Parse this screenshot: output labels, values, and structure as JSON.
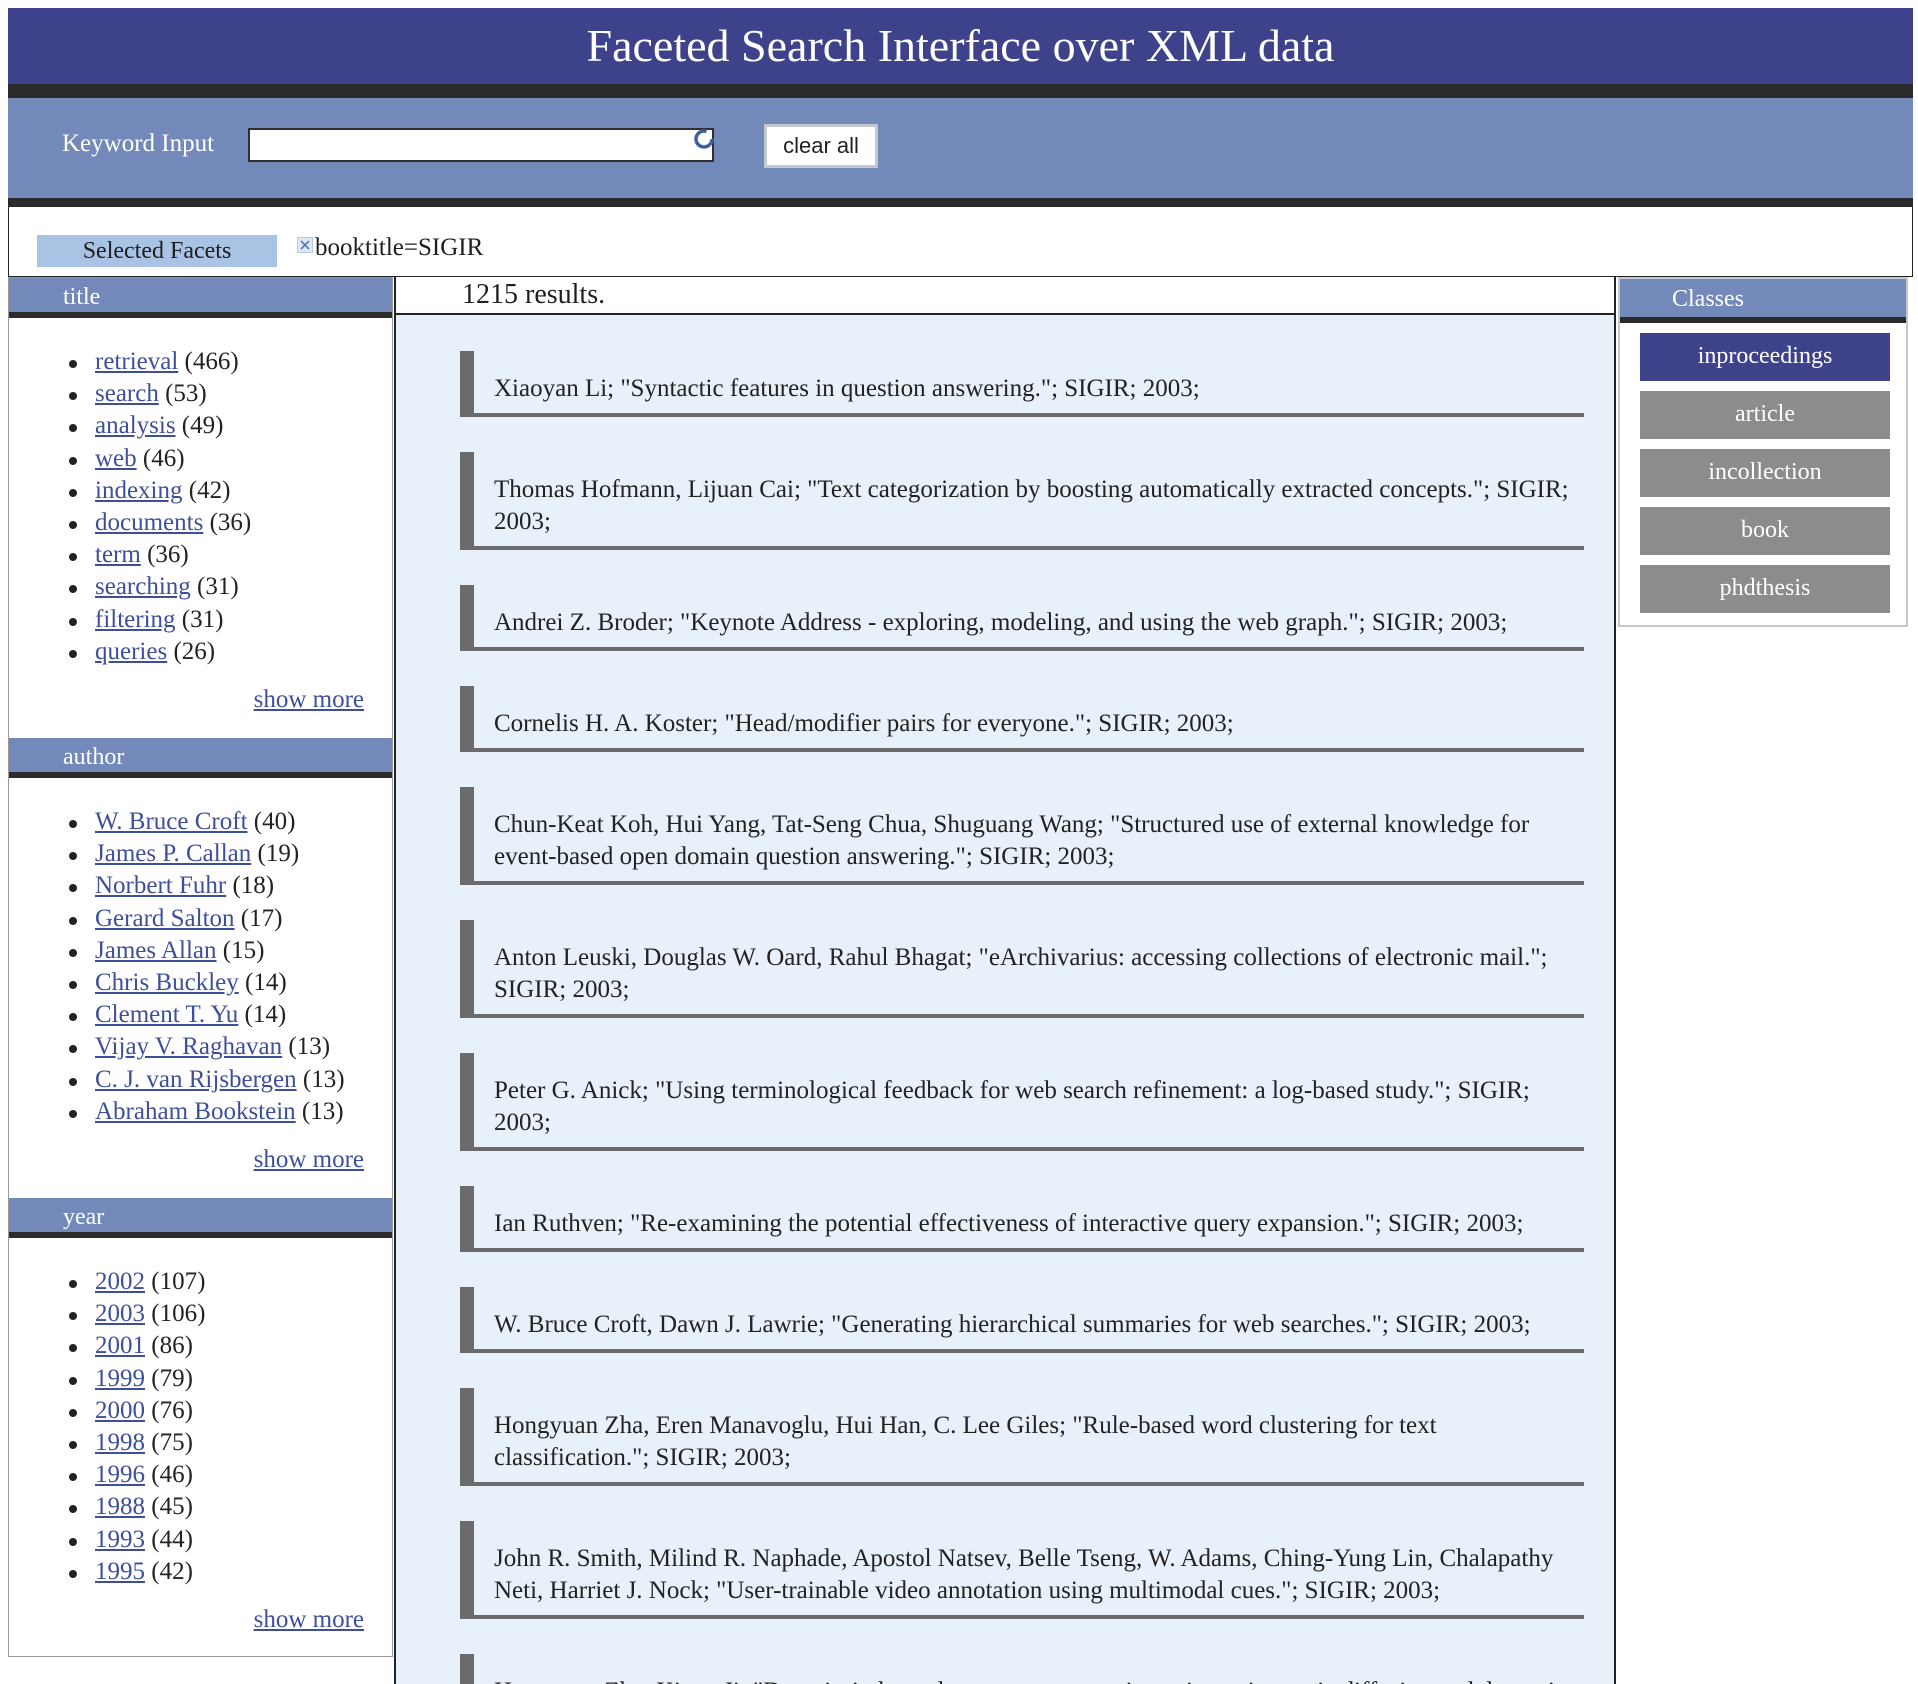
{
  "page_title": "Faceted Search Interface over XML data",
  "search": {
    "label": "Keyword Input",
    "value": "",
    "clear_label": "clear all"
  },
  "selected": {
    "label": "Selected Facets",
    "facet": "booktitle=SIGIR"
  },
  "facets": {
    "title": {
      "header": "title",
      "items": [
        {
          "label": "retrieval",
          "count": "(466)"
        },
        {
          "label": "search",
          "count": "(53)"
        },
        {
          "label": "analysis",
          "count": "(49)"
        },
        {
          "label": "web",
          "count": "(46)"
        },
        {
          "label": "indexing",
          "count": "(42)"
        },
        {
          "label": "documents",
          "count": "(36)"
        },
        {
          "label": "term",
          "count": "(36)"
        },
        {
          "label": "searching",
          "count": "(31)"
        },
        {
          "label": "filtering",
          "count": "(31)"
        },
        {
          "label": "queries",
          "count": "(26)"
        }
      ],
      "more": "show more"
    },
    "author": {
      "header": "author",
      "items": [
        {
          "label": "W. Bruce Croft",
          "count": "(40)"
        },
        {
          "label": "James P. Callan",
          "count": "(19)"
        },
        {
          "label": "Norbert Fuhr",
          "count": "(18)"
        },
        {
          "label": "Gerard Salton",
          "count": "(17)"
        },
        {
          "label": "James Allan",
          "count": "(15)"
        },
        {
          "label": "Chris Buckley",
          "count": "(14)"
        },
        {
          "label": "Clement T. Yu",
          "count": "(14)"
        },
        {
          "label": "Vijay V. Raghavan",
          "count": "(13)"
        },
        {
          "label": "C. J. van Rijsbergen",
          "count": "(13)"
        },
        {
          "label": "Abraham Bookstein",
          "count": "(13)"
        }
      ],
      "more": "show more"
    },
    "year": {
      "header": "year",
      "items": [
        {
          "label": "2002",
          "count": "(107)"
        },
        {
          "label": "2003",
          "count": "(106)"
        },
        {
          "label": "2001",
          "count": "(86)"
        },
        {
          "label": "1999",
          "count": "(79)"
        },
        {
          "label": "2000",
          "count": "(76)"
        },
        {
          "label": "1998",
          "count": "(75)"
        },
        {
          "label": "1996",
          "count": "(46)"
        },
        {
          "label": "1988",
          "count": "(45)"
        },
        {
          "label": "1993",
          "count": "(44)"
        },
        {
          "label": "1995",
          "count": "(42)"
        }
      ],
      "more": "show more"
    }
  },
  "results": {
    "count_text": "1215 results.",
    "items": [
      "Xiaoyan Li; \"Syntactic features in question answering.\"; SIGIR; 2003;",
      "Thomas Hofmann, Lijuan Cai; \"Text categorization by boosting automatically extracted concepts.\"; SIGIR; 2003;",
      "Andrei Z. Broder; \"Keynote Address - exploring, modeling, and using the web graph.\"; SIGIR; 2003;",
      "Cornelis H. A. Koster; \"Head/modifier pairs for everyone.\"; SIGIR; 2003;",
      "Chun-Keat Koh, Hui Yang, Tat-Seng Chua, Shuguang Wang; \"Structured use of external knowledge for event-based open domain question answering.\"; SIGIR; 2003;",
      "Anton Leuski, Douglas W. Oard, Rahul Bhagat; \"eArchivarius: accessing collections of electronic mail.\"; SIGIR; 2003;",
      "Peter G. Anick; \"Using terminological feedback for web search refinement: a log-based study.\"; SIGIR; 2003;",
      "Ian Ruthven; \"Re-examining the potential effectiveness of interactive query expansion.\"; SIGIR; 2003;",
      "W. Bruce Croft, Dawn J. Lawrie; \"Generating hierarchical summaries for web searches.\"; SIGIR; 2003;",
      "Hongyuan Zha, Eren Manavoglu, Hui Han, C. Lee Giles; \"Rule-based word clustering for text classification.\"; SIGIR; 2003;",
      "John R. Smith, Milind R. Naphade, Apostol Natsev, Belle Tseng, W. Adams, Ching-Yung Lin, Chalapathy Neti, Harriet J. Nock; \"User-trainable video annotation using multimodal cues.\"; SIGIR; 2003;",
      "Hongyuan Zha, Xiang Ji; \"Domain-independent text segmentation using anisotropic diffusion and dynamic programming.\"; SIGIR; 2003;"
    ]
  },
  "classes": {
    "header": "Classes",
    "items": [
      "inproceedings",
      "article",
      "incollection",
      "book",
      "phdthesis"
    ],
    "active": "inproceedings"
  },
  "colors": {
    "title_bar": "#3e428a",
    "bar_blue": "#7389b9",
    "result_bg": "#e8f0fa",
    "link": "#3d4f9a",
    "class_inactive": "#8c8c8c"
  }
}
